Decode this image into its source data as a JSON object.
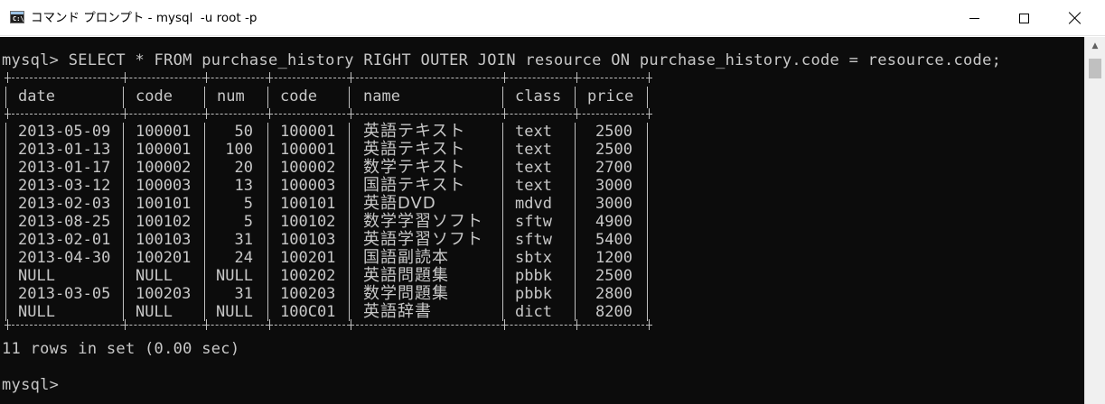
{
  "window": {
    "title": "コマンド プロンプト - mysql  -u root -p",
    "icon_label": "C:\\"
  },
  "console": {
    "query_line": "mysql> SELECT * FROM purchase_history RIGHT OUTER JOIN resource ON purchase_history.code = resource.code;",
    "headers": [
      "date",
      "code",
      "num",
      "code",
      "name",
      "class",
      "price"
    ],
    "rows": [
      [
        "2013-05-09",
        "100001",
        "50",
        "100001",
        "英語テキスト",
        "text",
        "2500"
      ],
      [
        "2013-01-13",
        "100001",
        "100",
        "100001",
        "英語テキスト",
        "text",
        "2500"
      ],
      [
        "2013-01-17",
        "100002",
        "20",
        "100002",
        "数学テキスト",
        "text",
        "2700"
      ],
      [
        "2013-03-12",
        "100003",
        "13",
        "100003",
        "国語テキスト",
        "text",
        "3000"
      ],
      [
        "2013-02-03",
        "100101",
        "5",
        "100101",
        "英語DVD",
        "mdvd",
        "3000"
      ],
      [
        "2013-08-25",
        "100102",
        "5",
        "100102",
        "数学学習ソフト",
        "sftw",
        "4900"
      ],
      [
        "2013-02-01",
        "100103",
        "31",
        "100103",
        "英語学習ソフト",
        "sftw",
        "5400"
      ],
      [
        "2013-04-30",
        "100201",
        "24",
        "100201",
        "国語副読本",
        "sbtx",
        "1200"
      ],
      [
        "NULL",
        "NULL",
        "NULL",
        "100202",
        "英語問題集",
        "pbbk",
        "2500"
      ],
      [
        "2013-03-05",
        "100203",
        "31",
        "100203",
        "数学問題集",
        "pbbk",
        "2800"
      ],
      [
        "NULL",
        "NULL",
        "NULL",
        "100C01",
        "英語辞書",
        "dict",
        "8200"
      ]
    ],
    "result_line": "11 rows in set (0.00 sec)",
    "prompt": "mysql>"
  },
  "colors": {
    "console_bg": "#0c0c0c",
    "console_text": "#c8c8c8"
  }
}
